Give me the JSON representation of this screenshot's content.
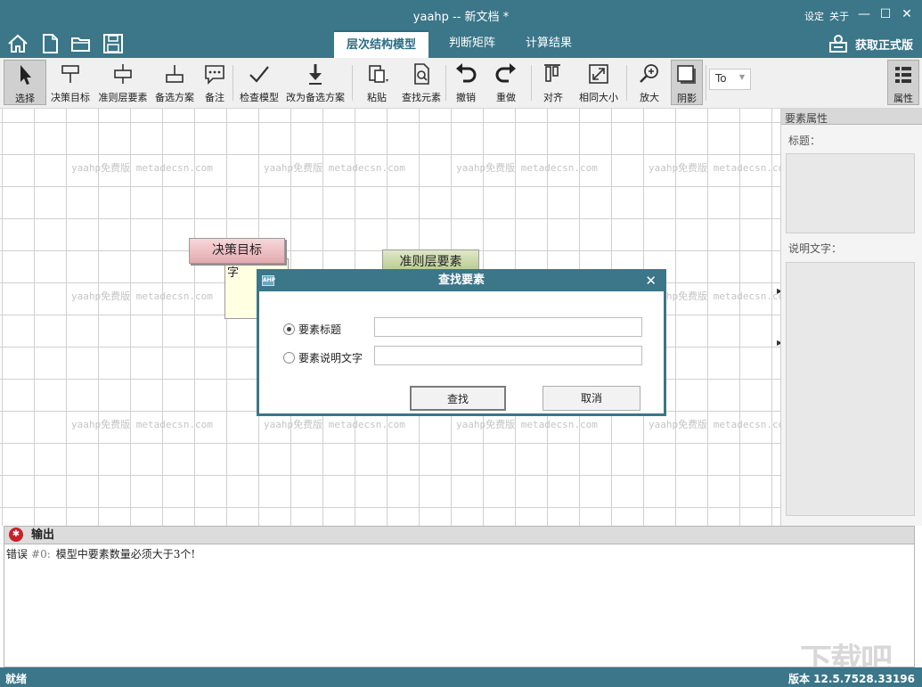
{
  "window": {
    "title": "yaahp -- 新文档 *",
    "settings": "设定",
    "about": "关于",
    "minimize_glyph": "—",
    "maximize_glyph": "☐",
    "close_glyph": "✕"
  },
  "tabs": [
    {
      "label": "层次结构模型",
      "active": true
    },
    {
      "label": "判断矩阵",
      "active": false
    },
    {
      "label": "计算结果",
      "active": false
    }
  ],
  "get_pro_label": "获取正式版",
  "toolbar": {
    "select": "选择",
    "goal": "决策目标",
    "criterion": "准则层要素",
    "alternative": "备选方案",
    "note": "备注",
    "check_model": "检查模型",
    "to_alternative": "改为备选方案",
    "paste": "粘贴",
    "find_element": "查找元素",
    "undo": "撤销",
    "redo": "重做",
    "align": "对齐",
    "same_size": "相同大小",
    "zoom_in": "放大",
    "shadow": "阴影",
    "font_value": "To",
    "properties": "属性"
  },
  "canvas": {
    "watermark": "yaahp免费版 metadecsn.com",
    "node_goal": "决策目标",
    "node_criterion": "准则层要素",
    "note_text": "字"
  },
  "props": {
    "header": "要素属性",
    "title_label": "标题：",
    "desc_label": "说明文字："
  },
  "output": {
    "header": "输出",
    "line_prefix": "错误",
    "line_code": "#0:",
    "line_message": "模型中要素数量必须大于3个!"
  },
  "status": {
    "ready": "就绪",
    "version": "版本 12.5.7528.33196"
  },
  "corner_watermark": "下载吧",
  "dialog": {
    "title": "查找要素",
    "icon_text": "AHP",
    "close_glyph": "✕",
    "option_title": "要素标题",
    "option_desc": "要素说明文字",
    "selected_option": "option_title",
    "input_title_value": "",
    "input_desc_value": "",
    "find_button": "查找",
    "cancel_button": "取消"
  },
  "colors": {
    "chrome": "#3b7689",
    "goal_node": "#e4aab0",
    "criterion_node": "#b7c98c",
    "error_icon": "#c8202a"
  }
}
